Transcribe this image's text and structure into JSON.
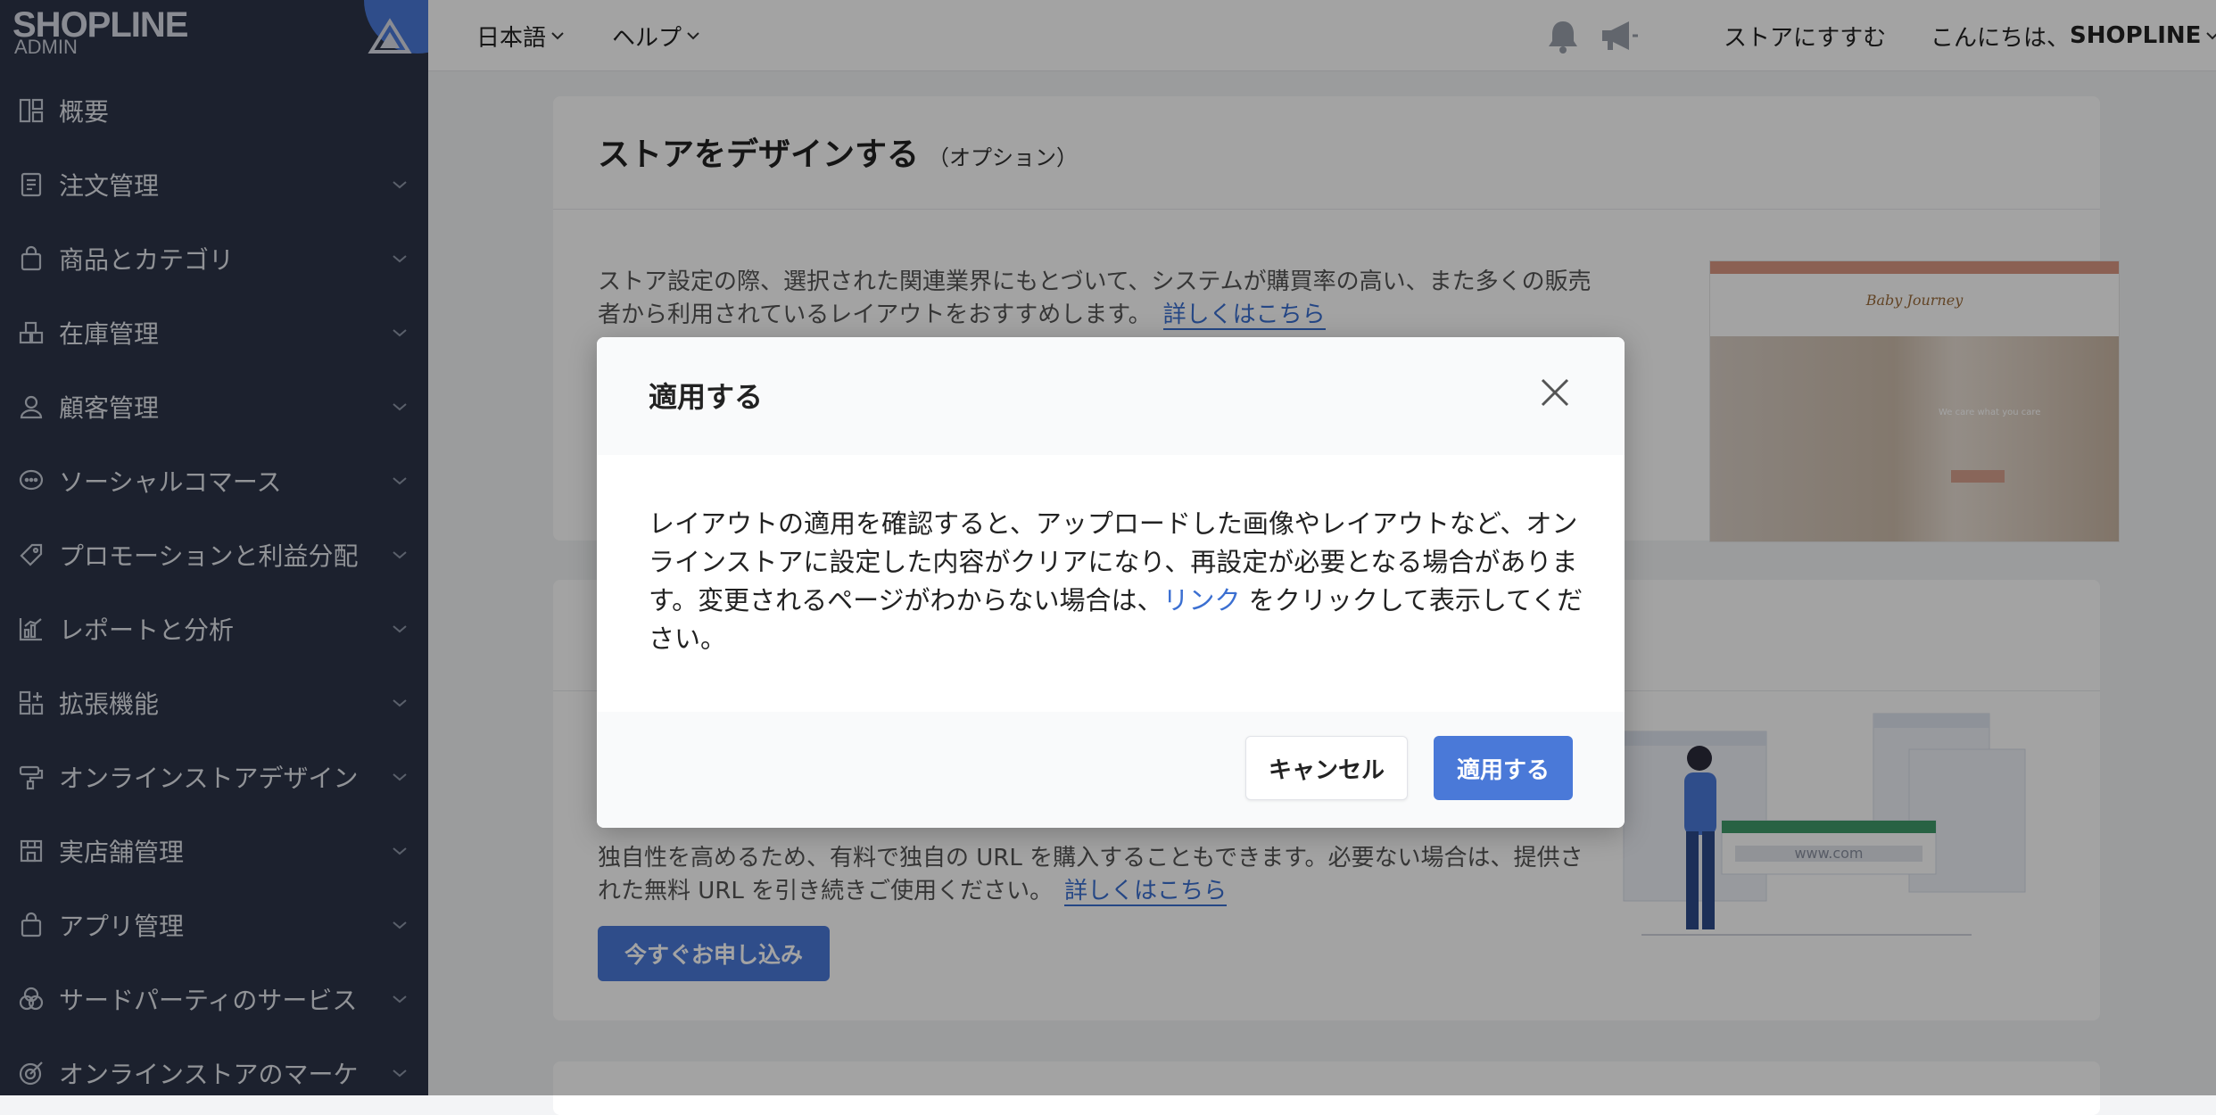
{
  "brand": {
    "logo_text": "SHOPLINE",
    "logo_sub": "ADMIN"
  },
  "sidebar": {
    "items": [
      {
        "label": "概要",
        "icon": "dashboard-icon",
        "expandable": false
      },
      {
        "label": "注文管理",
        "icon": "document-icon",
        "expandable": true
      },
      {
        "label": "商品とカテゴリ",
        "icon": "bag-icon",
        "expandable": true
      },
      {
        "label": "在庫管理",
        "icon": "boxes-icon",
        "expandable": true
      },
      {
        "label": "顧客管理",
        "icon": "person-icon",
        "expandable": true
      },
      {
        "label": "ソーシャルコマース",
        "icon": "chat-icon",
        "expandable": true
      },
      {
        "label": "プロモーションと利益分配",
        "icon": "tag-icon",
        "expandable": true
      },
      {
        "label": "レポートと分析",
        "icon": "chart-icon",
        "expandable": true
      },
      {
        "label": "拡張機能",
        "icon": "apps-icon",
        "expandable": true
      },
      {
        "label": "オンラインストアデザイン",
        "icon": "paint-roller-icon",
        "expandable": true
      },
      {
        "label": "実店舗管理",
        "icon": "store-icon",
        "expandable": true
      },
      {
        "label": "アプリ管理",
        "icon": "bag-icon",
        "expandable": true
      },
      {
        "label": "サードパーティのサービス",
        "icon": "circles-icon",
        "expandable": true
      },
      {
        "label": "オンラインストアのマーケ",
        "icon": "target-icon",
        "expandable": true
      }
    ]
  },
  "topbar": {
    "language": "日本語",
    "help": "ヘルプ",
    "go_to_store": "ストアにすすむ",
    "greeting": "こんにちは、",
    "user_name": "SHOPLINE"
  },
  "design_card": {
    "title": "ストアをデザインする",
    "option": "（オプション）",
    "description": "ストア設定の際、選択された関連業界にもとづいて、システムが購買率の高い、また多くの販売者から利用されているレイアウトをおすすめします。",
    "learn_more": "詳しくはこちら",
    "preview_brand": "Baby Journey",
    "preview_tagline": "We care what you care"
  },
  "domain_card": {
    "description": "独自性を高めるため、有料で独自の URL を購入することもできます。必要ない場合は、提供された無料 URL を引き続きご使用ください。",
    "learn_more": "詳しくはこちら",
    "apply_button": "今すぐお申し込み",
    "illustration_url": "www.com"
  },
  "modal": {
    "title": "適用する",
    "body_before": "レイアウトの適用を確認すると、アップロードした画像やレイアウトなど、オンラインストアに設定した内容がクリアになり、再設定が必要となる場合があります。変更されるページがわからない場合は、",
    "body_link": "リンク",
    "body_after": " をクリックして表示してください。",
    "cancel": "キャンセル",
    "apply": "適用する"
  },
  "colors": {
    "sidebar_bg": "#2c3448",
    "accent": "#4a79d8",
    "link": "#3b6fd1"
  }
}
